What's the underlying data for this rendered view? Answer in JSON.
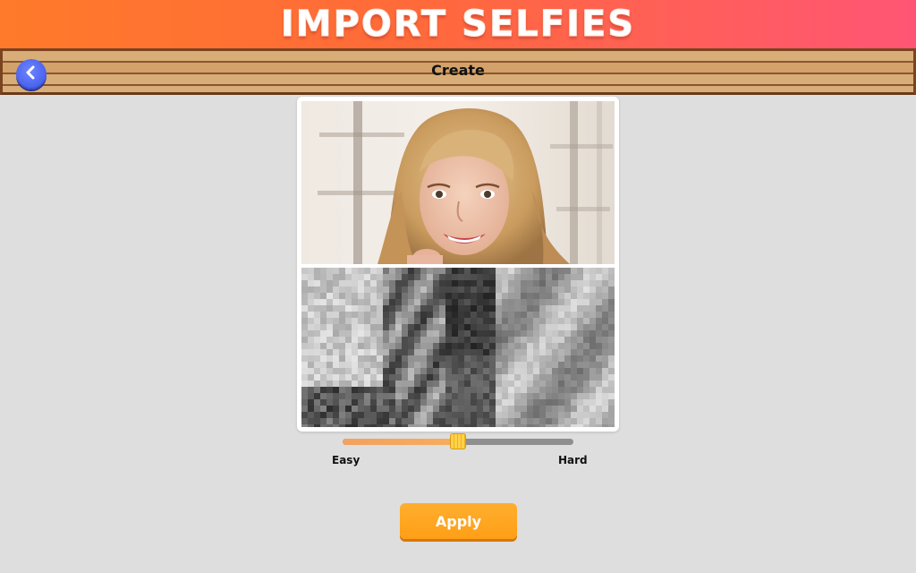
{
  "banner": {
    "title": "IMPORT SELFIES"
  },
  "toolbar": {
    "title": "Create",
    "back_icon": "chevron-left-icon"
  },
  "preview": {
    "photo_description_hidden": null,
    "difficulty_level": 0.5
  },
  "difficulty": {
    "min_label": "Easy",
    "max_label": "Hard",
    "value": 0.5
  },
  "apply_label": "Apply",
  "colors": {
    "banner_start": "#ff7a2a",
    "banner_end": "#ff5575",
    "back_button": "#4a63ef",
    "apply_button": "#ffa01a",
    "slider_fill": "#f3a15f",
    "slider_thumb": "#ffd24a"
  }
}
